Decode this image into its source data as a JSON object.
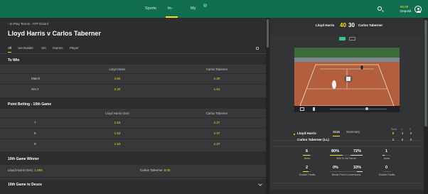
{
  "topnav": {
    "items": [
      "Sports",
      "In-Play",
      "My Bets"
    ],
    "active": "In-Play",
    "mybets_badge": "1",
    "balance": "€0.09",
    "deposit": "Deposit"
  },
  "event": {
    "breadcrumb": "‹ In-Play Tennis - ATP Estoril",
    "title": "Lloyd Harris v Carlos Taberner",
    "tabs": [
      "All",
      "Set Builder",
      "Set",
      "Games",
      "Player"
    ]
  },
  "to_win": {
    "title": "To Win",
    "headers": [
      "Lloyd Harris",
      "Carlos Taberner"
    ],
    "rows": [
      {
        "label": "Match",
        "odds": [
          "4.50",
          "1.20"
        ]
      },
      {
        "label": "Set 2",
        "odds": [
          "2.20",
          "1.61"
        ]
      }
    ]
  },
  "point_betting": {
    "title": "Point Betting - 10th Game",
    "headers": [
      "Lloyd Harris (Svr)",
      "Carlos Taberner"
    ],
    "rows": [
      {
        "label": "7",
        "odds": [
          "1.53",
          "2.37"
        ]
      },
      {
        "label": "8",
        "odds": [
          "1.53",
          "2.37"
        ]
      },
      {
        "label": "9",
        "odds": [
          "1.53",
          "2.37"
        ]
      }
    ]
  },
  "game_winner": {
    "title": "10th Game Winner",
    "left_label": "Lloyd Harris (Svr)",
    "left_odds": "1.083",
    "right_label": "Carlos Taberner",
    "right_odds": "8.00"
  },
  "deuce": {
    "title": "10th Game to Deuce"
  },
  "scoreboard": {
    "player1": "Lloyd Harris",
    "player2": "Carlos Taberner",
    "score1": "40",
    "score2": "30"
  },
  "stats": {
    "tabs": [
      "Stats",
      "Summary"
    ],
    "set_headers": [
      "Sets",
      "1",
      "2"
    ],
    "players": [
      {
        "name": "Lloyd Harris",
        "sets": "0",
        "s1": "3",
        "s2": "0"
      },
      {
        "name": "Carlos Taberner (LL)",
        "sets": "1",
        "s1": "6",
        "s2": "0"
      }
    ],
    "aces": {
      "p1": "6",
      "p2": "1",
      "label": "Aces"
    },
    "first_serve": {
      "p1": "80%",
      "p2": "72%",
      "label": "Win % 1st Serve",
      "p1_frac": 0.8,
      "p2_frac": 0.72
    },
    "double_faults": {
      "p1": "2",
      "p2": "0",
      "label": "Double Faults"
    },
    "break_points": {
      "p1": "0%",
      "p2": "33%",
      "label": "Break Point Conversions",
      "p1_frac": 0.0,
      "p2_frac": 0.33
    }
  },
  "colors": {
    "brand": "#126e51",
    "odds": "#ffdf1b",
    "background": "#2b2d2e"
  }
}
